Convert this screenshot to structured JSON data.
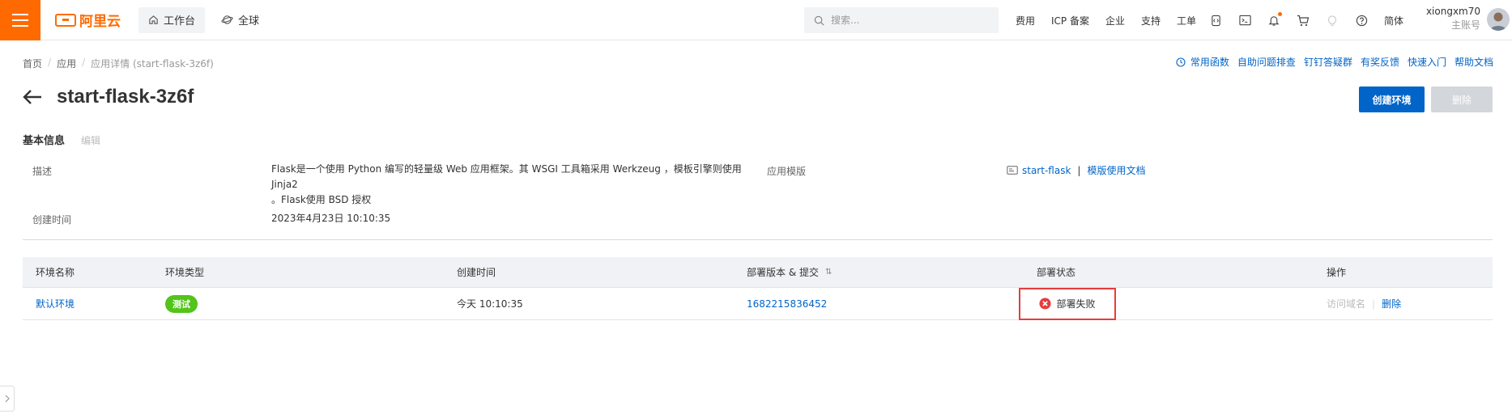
{
  "brand": {
    "name": "阿里云",
    "color": "#ff6a00"
  },
  "nav": {
    "workbench": "工作台",
    "global": "全球"
  },
  "search": {
    "placeholder": "搜索..."
  },
  "top_links": [
    "费用",
    "ICP 备案",
    "企业",
    "支持",
    "工单"
  ],
  "lang": "简体",
  "user": {
    "name": "xiongxm70",
    "role": "主账号"
  },
  "breadcrumb": [
    "首页",
    "应用",
    "应用详情 (start-flask-3z6f)"
  ],
  "help_links": [
    "常用函数",
    "自助问题排查",
    "钉钉答疑群",
    "有奖反馈",
    "快速入门",
    "帮助文档"
  ],
  "page": {
    "title": "start-flask-3z6f",
    "create_env_button": "创建环境",
    "delete_button": "删除"
  },
  "info": {
    "section_title": "基本信息",
    "edit": "编辑",
    "desc_label": "描述",
    "desc_line1": "Flask是一个使用 Python 编写的轻量级 Web 应用框架。其 WSGI 工具箱采用 Werkzeug ，模板引擎则使用 Jinja2",
    "desc_line2": "。Flask使用 BSD 授权",
    "template_label": "应用模版",
    "template_name": "start-flask",
    "template_sep": "|",
    "template_doc": "模版使用文档",
    "created_label": "创建时间",
    "created_value": "2023年4月23日 10:10:35"
  },
  "table": {
    "headers": [
      "环境名称",
      "环境类型",
      "创建时间",
      "部署版本 & 提交",
      "部署状态",
      "操作"
    ],
    "sort_icon": "⇅",
    "rows": [
      {
        "env_name": "默认环境",
        "env_type": "测试",
        "created": "今天 10:10:35",
        "version": "1682215836452",
        "status": "部署失败",
        "op_visit": "访问域名",
        "op_delete": "删除"
      }
    ]
  },
  "colors": {
    "primary": "#0064c8",
    "success": "#52c41a",
    "error": "#e53e3e"
  }
}
